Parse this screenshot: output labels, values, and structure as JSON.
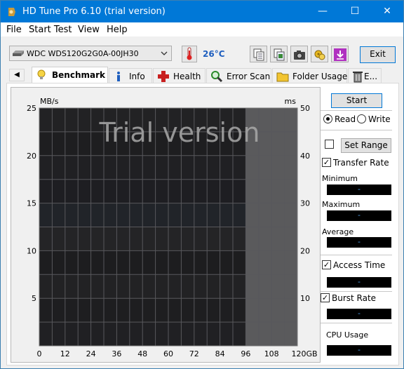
{
  "window": {
    "title": "HD Tune Pro 6.10 (trial version)",
    "minimize_glyph": "—",
    "maximize_glyph": "☐",
    "close_glyph": "✕"
  },
  "menu": {
    "items": [
      "File",
      "Start Test",
      "View",
      "Help"
    ]
  },
  "toolbar": {
    "drive": "WDC WDS120G2G0A-00JH30",
    "temperature": "26°C",
    "exit_label": "Exit",
    "icons": [
      "copy-info-icon",
      "copy-screenshot-icon",
      "camera-icon",
      "options-icon",
      "save-icon"
    ]
  },
  "tabs": {
    "scroll_glyph": "◀",
    "items": [
      {
        "label": "Benchmark",
        "icon": "lightbulb-icon",
        "active": true
      },
      {
        "label": "Info",
        "icon": "info-icon",
        "active": false
      },
      {
        "label": "Health",
        "icon": "health-cross-icon",
        "active": false
      },
      {
        "label": "Error Scan",
        "icon": "magnifier-icon",
        "active": false
      },
      {
        "label": "Folder Usage",
        "icon": "folder-icon",
        "active": false
      },
      {
        "label": "E...",
        "icon": "trash-icon",
        "active": false
      }
    ]
  },
  "chart_data": {
    "type": "line",
    "watermark": "Trial version",
    "left_unit": "MB/s",
    "right_unit": "ms",
    "x_unit": "GB",
    "x_ticks": [
      0,
      12,
      24,
      36,
      48,
      60,
      72,
      84,
      96,
      108,
      120
    ],
    "y_left_ticks": [
      5,
      10,
      15,
      20,
      25
    ],
    "y_right_ticks": [
      10,
      20,
      30,
      40,
      50
    ],
    "x_range": [
      0,
      120
    ],
    "y_left_range": [
      0,
      25
    ],
    "y_right_range": [
      0,
      50
    ],
    "grid": true,
    "disk_end_gb": 96,
    "series": []
  },
  "controls": {
    "start_label": "Start",
    "read_label": "Read",
    "write_label": "Write",
    "read_selected": true,
    "set_range_label": "Set Range",
    "transfer_rate_label": "Transfer Rate",
    "transfer_rate_checked": true,
    "minimum_label": "Minimum",
    "minimum_value": "-",
    "maximum_label": "Maximum",
    "maximum_value": "-",
    "average_label": "Average",
    "average_value": "-",
    "access_time_label": "Access Time",
    "access_time_checked": true,
    "access_time_value": "-",
    "burst_rate_label": "Burst Rate",
    "burst_rate_checked": true,
    "burst_rate_value": "-",
    "cpu_usage_label": "CPU Usage",
    "cpu_usage_value": "-"
  },
  "colors": {
    "titlebar": "#0078d7",
    "accent": "#0078d7",
    "temperature": "#1f5fbf",
    "stat_value": "#4a9de8"
  }
}
